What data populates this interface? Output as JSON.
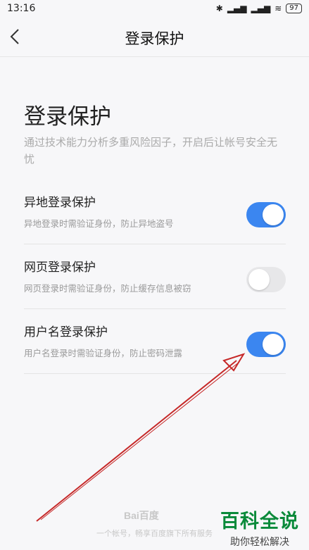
{
  "status_bar": {
    "time": "13:16",
    "battery": "97",
    "icons": [
      "bluetooth-icon",
      "signal-icon",
      "signal-icon",
      "wifi-icon",
      "battery-icon"
    ]
  },
  "header": {
    "title": "登录保护",
    "back_icon": "chevron-left-icon"
  },
  "main": {
    "title": "登录保护",
    "description": "通过技术能力分析多重风险因子，开启后让帐号安全无忧",
    "settings": [
      {
        "title": "异地登录保护",
        "description": "异地登录时需验证身份，防止异地盗号",
        "enabled": true
      },
      {
        "title": "网页登录保护",
        "description": "网页登录时需验证身份，防止缓存信息被窃",
        "enabled": false
      },
      {
        "title": "用户名登录保护",
        "description": "用户名登录时需验证身份，防止密码泄露",
        "enabled": true
      }
    ]
  },
  "footer": {
    "logo": "Bai百度",
    "text": "一个帐号，畅享百度旗下所有服务"
  },
  "watermark": {
    "title": "百科全说",
    "subtitle": "助你轻松解决"
  },
  "colors": {
    "accent": "#3b86f0",
    "toggle_off": "#e7e7e9",
    "annotation_arrow": "#c62828"
  }
}
